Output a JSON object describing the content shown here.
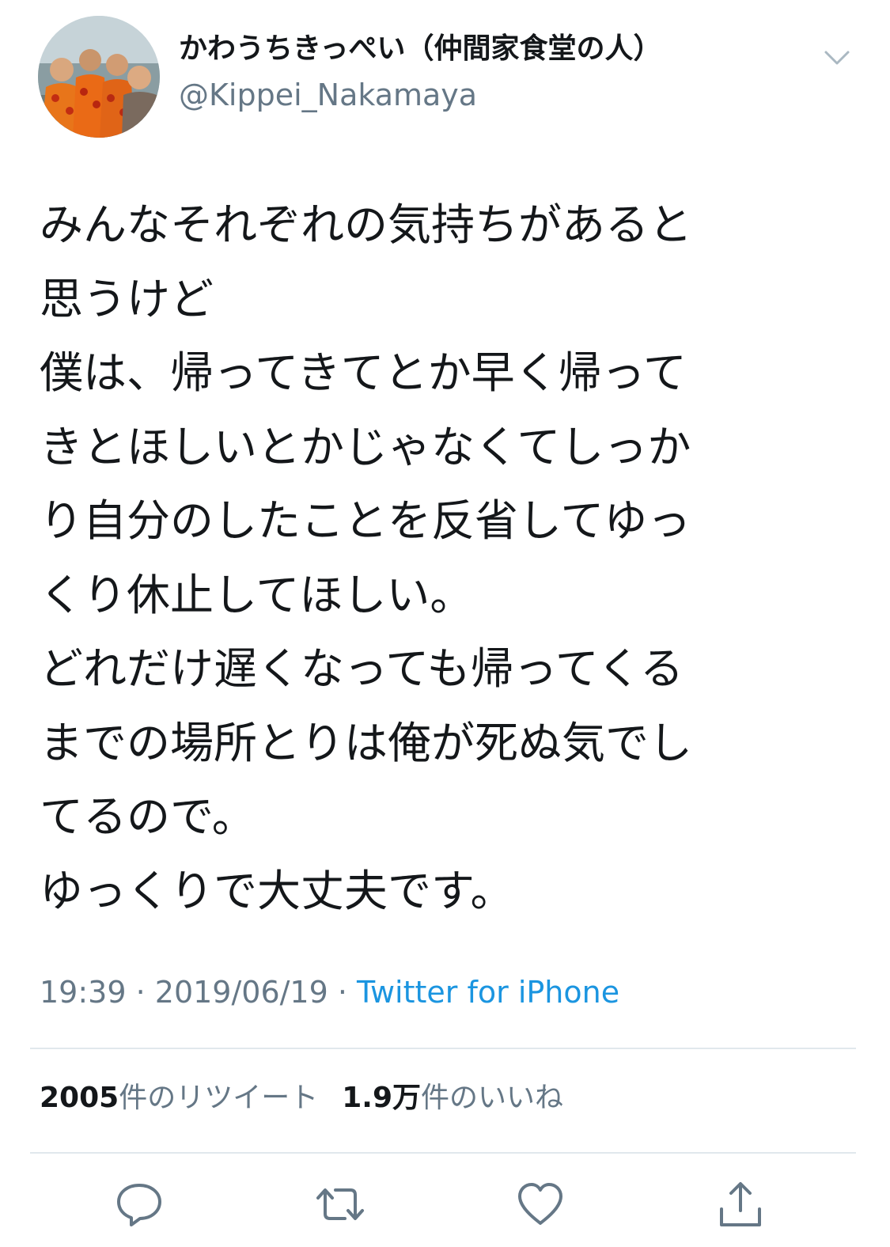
{
  "user": {
    "display_name": "かわうちきっぺい（仲間家食堂の人）",
    "handle": "@Kippei_Nakamaya",
    "avatar_icon": "profile-photo"
  },
  "tweet": {
    "lines": [
      "みんなそれぞれの気持ちがあると",
      "思うけど",
      "僕は、帰ってきてとか早く帰って",
      "きとほしいとかじゃなくてしっか",
      "り自分のしたことを反省してゆっ",
      "くり休止してほしい。",
      "どれだけ遅くなっても帰ってくる",
      "までの場所とりは俺が死ぬ気でし",
      "てるので。",
      "ゆっくりで大丈夫です。"
    ]
  },
  "meta": {
    "time": "19:39",
    "separator": " · ",
    "date": "2019/06/19",
    "source": "Twitter for iPhone"
  },
  "stats": {
    "retweet_count": "2005",
    "retweet_label": "件のリツイート",
    "like_count": "1.9万",
    "like_label": "件のいいね"
  },
  "actions": {
    "reply_icon": "reply-icon",
    "retweet_icon": "retweet-icon",
    "like_icon": "heart-icon",
    "share_icon": "share-icon"
  },
  "colors": {
    "text": "#14171a",
    "secondary": "#657786",
    "link": "#1b95e0",
    "divider": "#e1e8ed"
  }
}
